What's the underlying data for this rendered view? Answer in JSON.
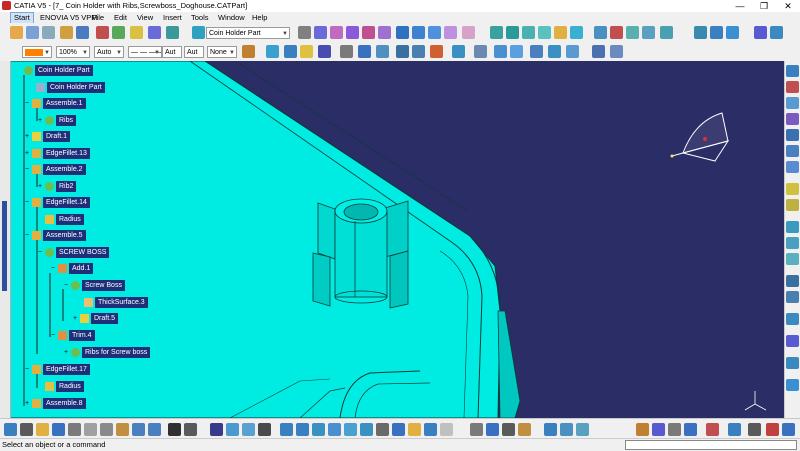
{
  "window": {
    "title": "CATIA V5 - [7_ Coin Holder with Ribs,Screwboss_Doghouse.CATPart]",
    "minimize": "—",
    "maximize": "❐",
    "close": "✕"
  },
  "menubar": {
    "items": [
      "Start",
      "ENOVIA V5 VPM",
      "File",
      "Edit",
      "View",
      "Insert",
      "Tools",
      "Window",
      "Help"
    ]
  },
  "toolbar": {
    "part_selector": "Coin Holder Part"
  },
  "properties_bar": {
    "color": "#ff7f00",
    "transparency": "100%",
    "line_thickness": "Auto",
    "line_type": "— — — —",
    "layer_a": "Aut",
    "layer_b": "Aut",
    "filter": "None"
  },
  "tree": {
    "nodes": [
      {
        "label": "Coin Holder Part",
        "icon": "part-icon"
      },
      {
        "label": "Coin Holder Part",
        "icon": "geometry-icon"
      },
      {
        "label": "Assemble.1",
        "icon": "assemble-icon"
      },
      {
        "label": "Ribs",
        "icon": "body-icon"
      },
      {
        "label": "Draft.1",
        "icon": "draft-icon"
      },
      {
        "label": "EdgeFillet.13",
        "icon": "fillet-icon"
      },
      {
        "label": "Assemble.2",
        "icon": "assemble-icon"
      },
      {
        "label": "Rib2",
        "icon": "body-icon"
      },
      {
        "label": "EdgeFillet.14",
        "icon": "fillet-icon"
      },
      {
        "label": "Radius",
        "icon": "radius-icon"
      },
      {
        "label": "Assemble.5",
        "icon": "assemble-icon"
      },
      {
        "label": "SCREW BOSS",
        "icon": "body-icon"
      },
      {
        "label": "Add.1",
        "icon": "add-icon"
      },
      {
        "label": "Screw Boss",
        "icon": "body-icon"
      },
      {
        "label": "ThickSurface.3",
        "icon": "thick-surface-icon"
      },
      {
        "label": "Draft.5",
        "icon": "draft-icon"
      },
      {
        "label": "Trim.4",
        "icon": "trim-icon"
      },
      {
        "label": "Ribs for Screw boss",
        "icon": "body-icon"
      },
      {
        "label": "EdgeFillet.17",
        "icon": "fillet-icon"
      },
      {
        "label": "Radius",
        "icon": "radius-icon"
      },
      {
        "label": "Assemble.8",
        "icon": "assemble-icon"
      }
    ]
  },
  "status": {
    "message": "Select an object or a command"
  },
  "colors": {
    "viewport_background": "#2b2d66",
    "part_surface": "#00e8e0",
    "part_edge": "#0a3a3a",
    "tree_highlight": "#1e2f7a"
  }
}
